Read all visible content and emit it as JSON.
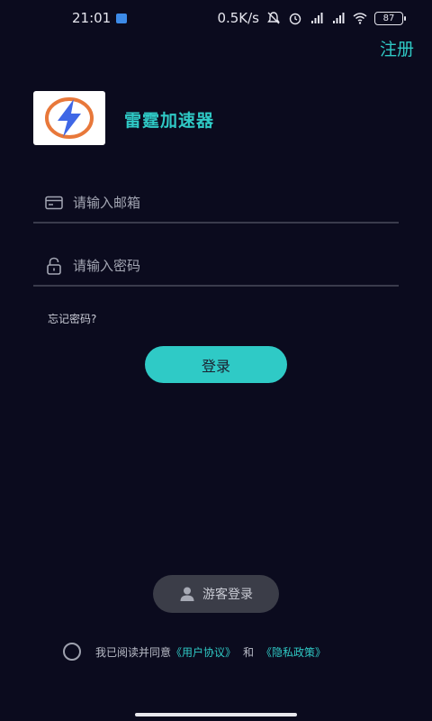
{
  "status_bar": {
    "time": "21:01",
    "network_speed": "0.5K/s",
    "battery": "87",
    "icons": [
      "app-notification-icon",
      "mute-icon",
      "alarm-icon",
      "signal-hd-icon",
      "signal-hd-icon",
      "wifi-icon",
      "battery-icon"
    ]
  },
  "header": {
    "register_label": "注册"
  },
  "brand": {
    "app_name": "雷霆加速器",
    "logo_icon": "lightning-bolt-icon"
  },
  "form": {
    "email_placeholder": "请输入邮箱",
    "email_value": "",
    "password_placeholder": "请输入密码",
    "password_value": "",
    "forgot_label": "忘记密码?",
    "login_label": "登录"
  },
  "guest": {
    "label": "游客登录"
  },
  "agreement": {
    "prefix": "我已阅读并同意",
    "user_agreement": "《用户协议》",
    "conjunction": "和",
    "privacy_policy": "《隐私政策》"
  },
  "colors": {
    "background": "#0b0b1e",
    "accent": "#2fc9c5",
    "guest_button": "#3b3d48"
  }
}
